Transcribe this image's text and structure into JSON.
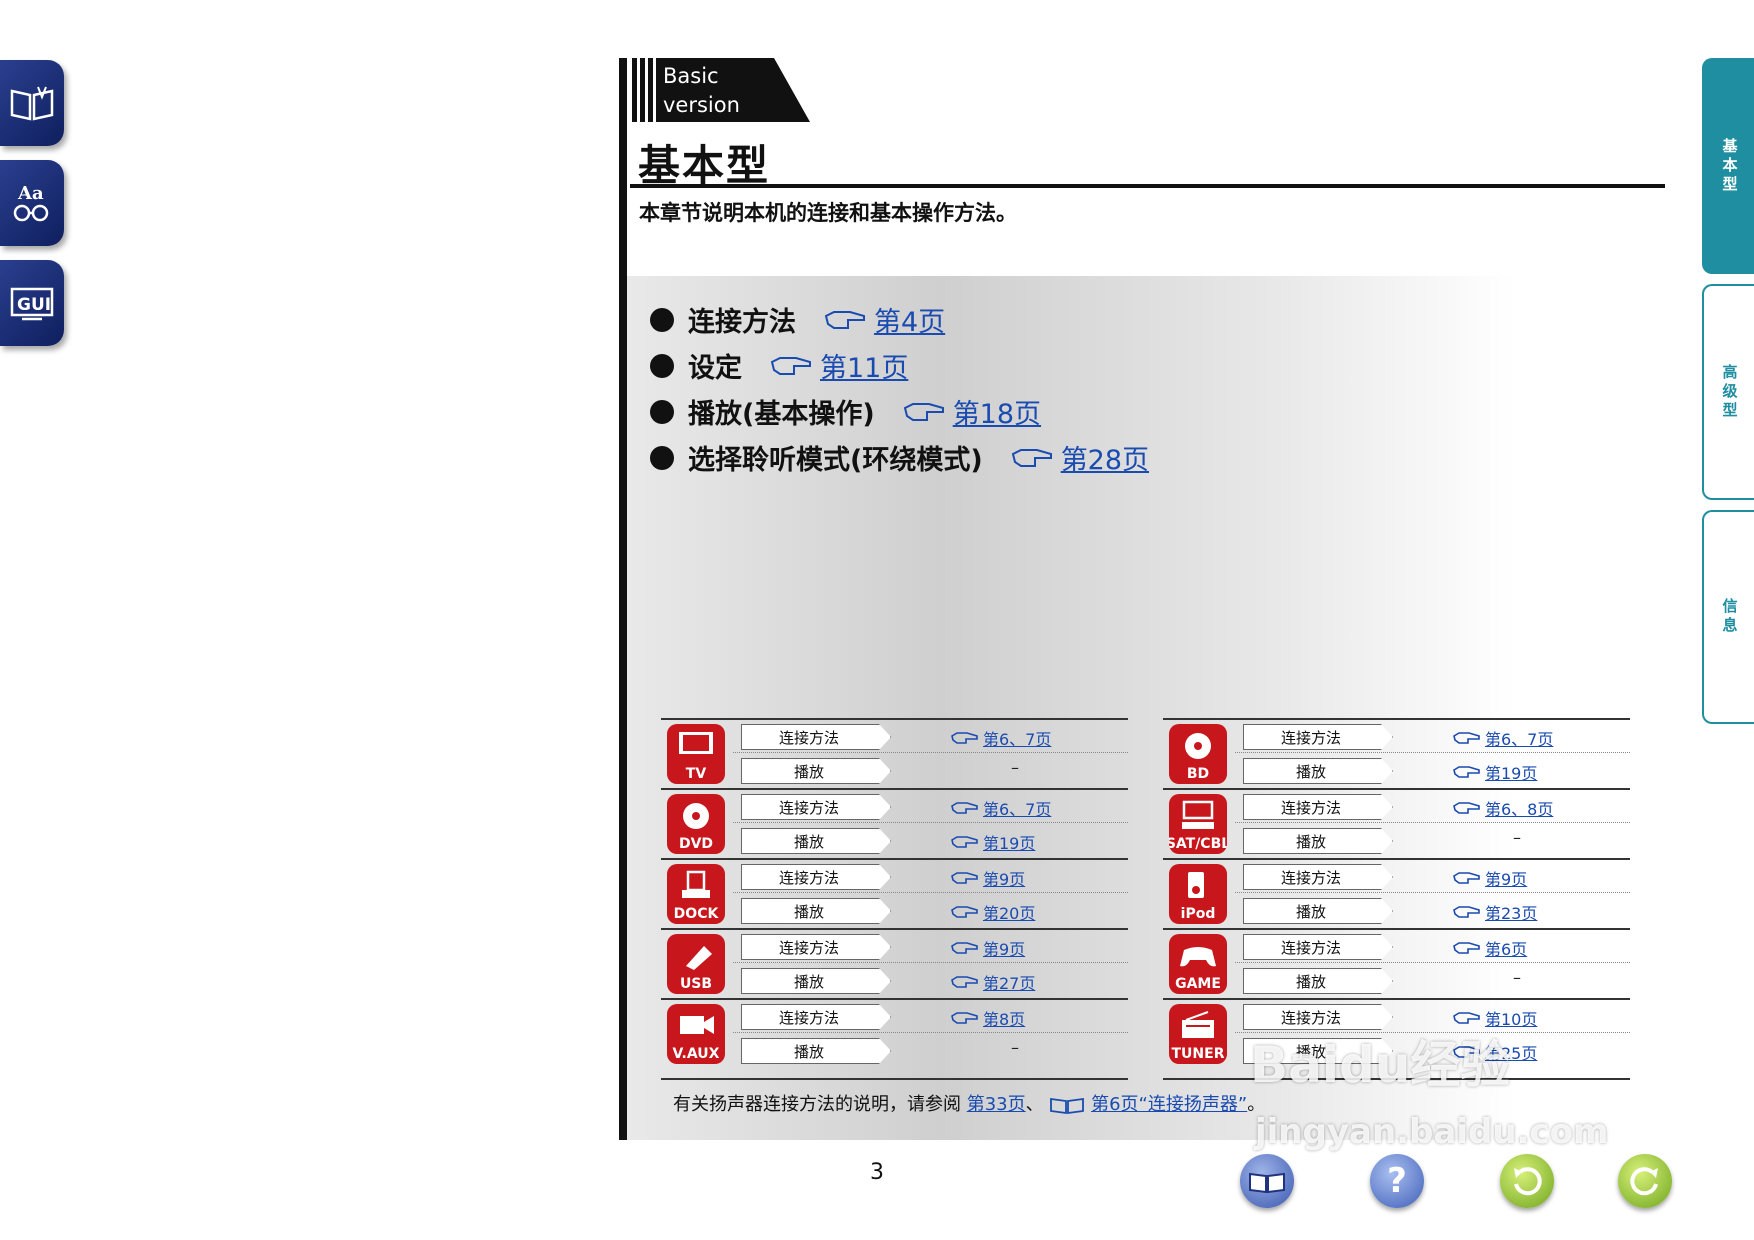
{
  "left_nav": [
    {
      "name": "contents-book-icon"
    },
    {
      "name": "glossary-aa-icon"
    },
    {
      "name": "gui-icon",
      "label": "GUI"
    }
  ],
  "right_tabs": [
    {
      "label": "基本型",
      "active": true
    },
    {
      "label": "高级型",
      "active": false
    },
    {
      "label": "信息",
      "active": false
    }
  ],
  "header": {
    "tag_line1": "Basic",
    "tag_line2": "version",
    "title": "基本型",
    "subtitle": "本章节说明本机的连接和基本操作方法。"
  },
  "toc": [
    {
      "label": "连接方法",
      "link": "第4页"
    },
    {
      "label": "设定",
      "link": "第11页"
    },
    {
      "label": "播放(基本操作)",
      "link": "第18页"
    },
    {
      "label": "选择聆听模式(环绕模式)",
      "link": "第28页"
    }
  ],
  "row_labels": {
    "connect": "连接方法",
    "play": "播放"
  },
  "devices_left": [
    {
      "icon": "tv-icon",
      "label": "TV",
      "connect": "第6、7页",
      "play": "–"
    },
    {
      "icon": "dvd-icon",
      "label": "DVD",
      "connect": "第6、7页",
      "play": "第19页"
    },
    {
      "icon": "dock-icon",
      "label": "DOCK",
      "connect": "第9页",
      "play": "第20页"
    },
    {
      "icon": "usb-icon",
      "label": "USB",
      "connect": "第9页",
      "play": "第27页"
    },
    {
      "icon": "vaux-icon",
      "label": "V.AUX",
      "connect": "第8页",
      "play": "–"
    }
  ],
  "devices_right": [
    {
      "icon": "bd-icon",
      "label": "BD",
      "connect": "第6、7页",
      "play": "第19页"
    },
    {
      "icon": "satcbl-icon",
      "label": "SAT/CBL",
      "connect": "第6、8页",
      "play": "–"
    },
    {
      "icon": "ipod-icon",
      "label": "iPod",
      "connect": "第9页",
      "play": "第23页"
    },
    {
      "icon": "game-icon",
      "label": "GAME",
      "connect": "第6页",
      "play": "–"
    },
    {
      "icon": "tuner-icon",
      "label": "TUNER",
      "connect": "第10页",
      "play": "第25页"
    }
  ],
  "footnote": {
    "text": "有关扬声器连接方法的说明，请参阅",
    "link1": "第33页",
    "sep": "、",
    "link2": "第6页“连接扬声器”",
    "end": "。"
  },
  "page_number": "3",
  "bottom_nav": [
    {
      "name": "manual-book-button"
    },
    {
      "name": "help-button",
      "label": "?"
    },
    {
      "name": "back-button"
    },
    {
      "name": "forward-button"
    }
  ],
  "watermark": {
    "line1": "Baidu经验",
    "line2": "jingyan.baidu.com"
  },
  "colors": {
    "accent_teal": "#1f8ea1",
    "device_red": "#c8161d",
    "link_blue": "#1a4bb0",
    "nav_navy": "#1f3380"
  }
}
